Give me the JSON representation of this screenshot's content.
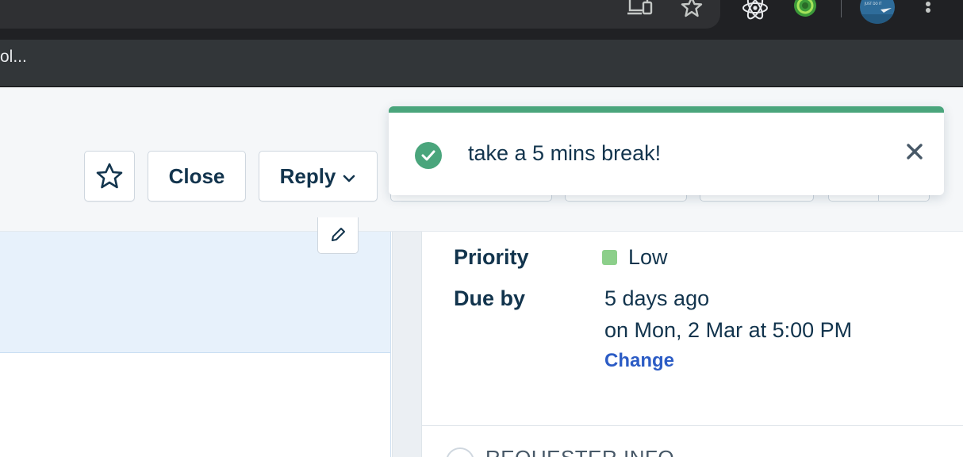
{
  "browser": {
    "bookmark_label": "ol...",
    "icons": [
      "devices-icon",
      "bookmark-star-icon",
      "react-devtools-icon",
      "extension-green-icon",
      "profile-avatar",
      "menu-dots-icon"
    ],
    "avatar_text": "JUST DO IT"
  },
  "toolbar": {
    "close_label": "Close",
    "reply_label": "Reply"
  },
  "ticket": {
    "priority_label": "Priority",
    "priority_value": "Low",
    "priority_color": "#8ccf8a",
    "due_label": "Due by",
    "due_relative": "5 days ago",
    "due_absolute": "on Mon, 2 Mar at 5:00 PM",
    "change_link": "Change",
    "section_title": "REQUESTER INFO"
  },
  "toast": {
    "message": "take a 5 mins break!",
    "accent_color": "#4aa57c"
  }
}
